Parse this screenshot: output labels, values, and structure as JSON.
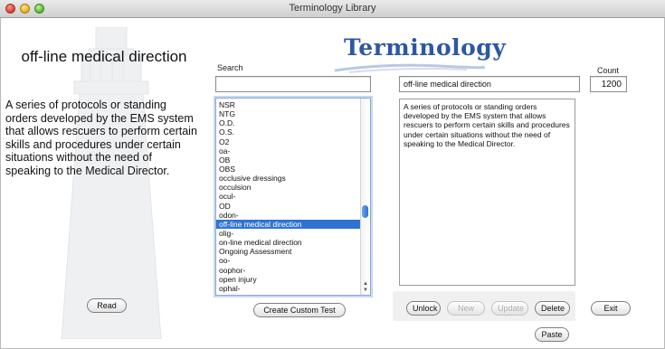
{
  "window": {
    "title": "Terminology Library"
  },
  "logo": {
    "text": "Terminology"
  },
  "left_panel": {
    "term": "off-line medical direction",
    "definition": "A series of protocols or standing orders developed by the EMS system that allows rescuers to perform certain skills and procedures under certain situations without the need of speaking to the Medical Director.",
    "read_label": "Read"
  },
  "search": {
    "label": "Search",
    "value": ""
  },
  "term_field": {
    "value": "off-line medical direction"
  },
  "count": {
    "label": "Count",
    "value": "1200"
  },
  "term_list": {
    "items": [
      "NSR",
      "NTG",
      "O.D.",
      "O.S.",
      "O2",
      "oa-",
      "OB",
      "OBS",
      "occlusive dressings",
      "occulsion",
      "ocul-",
      "OD",
      "odon-",
      "off-line medical direction",
      "olig-",
      "on-line medical direction",
      "Ongoing Assessment",
      "oo-",
      "oophor-",
      "open injury",
      "ophal-"
    ],
    "selected_index": 13
  },
  "definition_box": {
    "text": "A series of protocols or standing orders developed by the EMS system that allows rescuers to perform certain skills and procedures under certain situations without the need of speaking to the Medical Director."
  },
  "buttons": {
    "create_custom_test": "Create Custom Test",
    "unlock": "Unlock",
    "new": "New",
    "update": "Update",
    "delete": "Delete",
    "exit": "Exit",
    "paste": "Paste"
  },
  "colors": {
    "accent": "#2f74d0",
    "logo": "#2d57a6"
  }
}
